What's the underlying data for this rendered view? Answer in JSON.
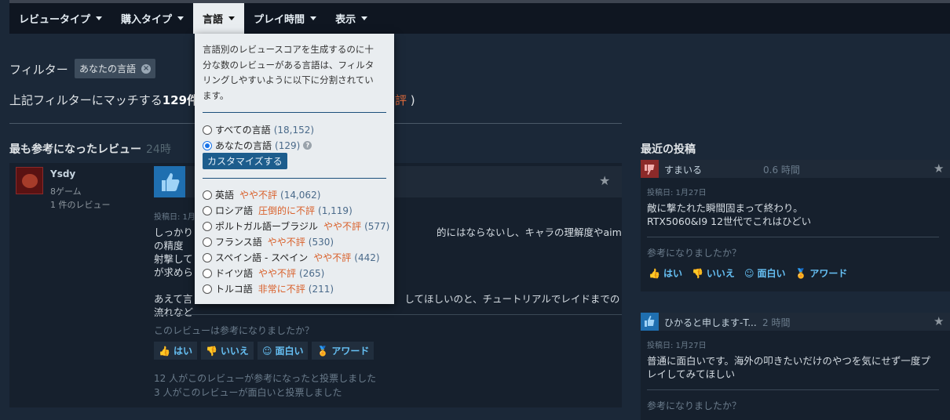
{
  "menu": [
    {
      "label": "レビュータイプ"
    },
    {
      "label": "購入タイプ"
    },
    {
      "label": "言語"
    },
    {
      "label": "プレイ時間"
    },
    {
      "label": "表示"
    }
  ],
  "filter": {
    "label": "フィルター",
    "chip": "あなたの言語"
  },
  "match": {
    "prefix": "上記フィルターにマッチする",
    "count": "129件",
    "tail_rating": "評",
    "tail_paren": " )"
  },
  "sections": {
    "most_helpful": "最も参考になったレビュー",
    "most_helpful_sub": "24時",
    "recent": "最近の投稿"
  },
  "review": {
    "user": "Ysdy",
    "games": "8ゲーム",
    "reviews": "1 件のレビュー",
    "posted": "投稿日: 1月",
    "body_p1_l1": "しっかり",
    "body_p1_l1_end": "的にはならないし、キャラの理解度やaimの精度",
    "body_p1_l2": "射撃して",
    "body_p1_l3": "が求めら",
    "body_p2_l1": "あえて言",
    "body_p2_l1_end": "してほしいのと、チュートリアルでレイドまでの",
    "body_p2_l2": "流れなど",
    "question": "このレビューは参考になりましたか？",
    "votes": {
      "yes": "はい",
      "no": "いいえ",
      "funny": "面白い",
      "award": "アワード"
    },
    "stat_helpful": "12 人がこのレビューが参考になったと投票しました",
    "stat_funny": "3 人がこのレビューが面白いと投票しました"
  },
  "posts": [
    {
      "name": "すまいる",
      "hours": "0.6 時間",
      "date": "投稿日: 1月27日",
      "text_l1": "敵に撃たれた瞬間固まって終わり。",
      "text_l2": "RTX5060&I9 12世代でこれはひどい",
      "question": "参考になりましたか？"
    },
    {
      "name": "ひかると申します-T...",
      "hours": "2 時間",
      "date": "投稿日: 1月27日",
      "text_l1": "普通に面白いです。海外の叩きたいだけのやつを気にせず一度プ",
      "text_l2": "レイしてみてほしい",
      "question": "参考になりましたか？"
    }
  ],
  "dropdown": {
    "desc_l1": "言語別のレビュースコアを生成するのに十",
    "desc_l2": "分な数のレビューがある言語は、フィルタ",
    "desc_l3": "リングしやすいように以下に分割されてい",
    "desc_l4": "ます。",
    "all": {
      "label": "すべての言語",
      "count": "(18,152)"
    },
    "yours": {
      "label": "あなたの言語",
      "count": "(129)"
    },
    "customize": "カスタマイズする",
    "languages": [
      {
        "label": "英語",
        "rating": "やや不評",
        "count": "(14,062)"
      },
      {
        "label": "ロシア語",
        "rating": "圧倒的に不評",
        "count": "(1,119)"
      },
      {
        "label": "ポルトガル語ーブラジル",
        "rating": "やや不評",
        "count": "(577)"
      },
      {
        "label": "フランス語",
        "rating": "やや不評",
        "count": "(530)"
      },
      {
        "label": "スペイン語 - スペイン",
        "rating": "やや不評",
        "count": "(442)"
      },
      {
        "label": "ドイツ語",
        "rating": "やや不評",
        "count": "(265)"
      },
      {
        "label": "トルコ語",
        "rating": "非常に不評",
        "count": "(211)"
      }
    ]
  },
  "colors": {
    "background": "#1b2838",
    "accent": "#66c0f4",
    "negative": "#d9602a"
  }
}
